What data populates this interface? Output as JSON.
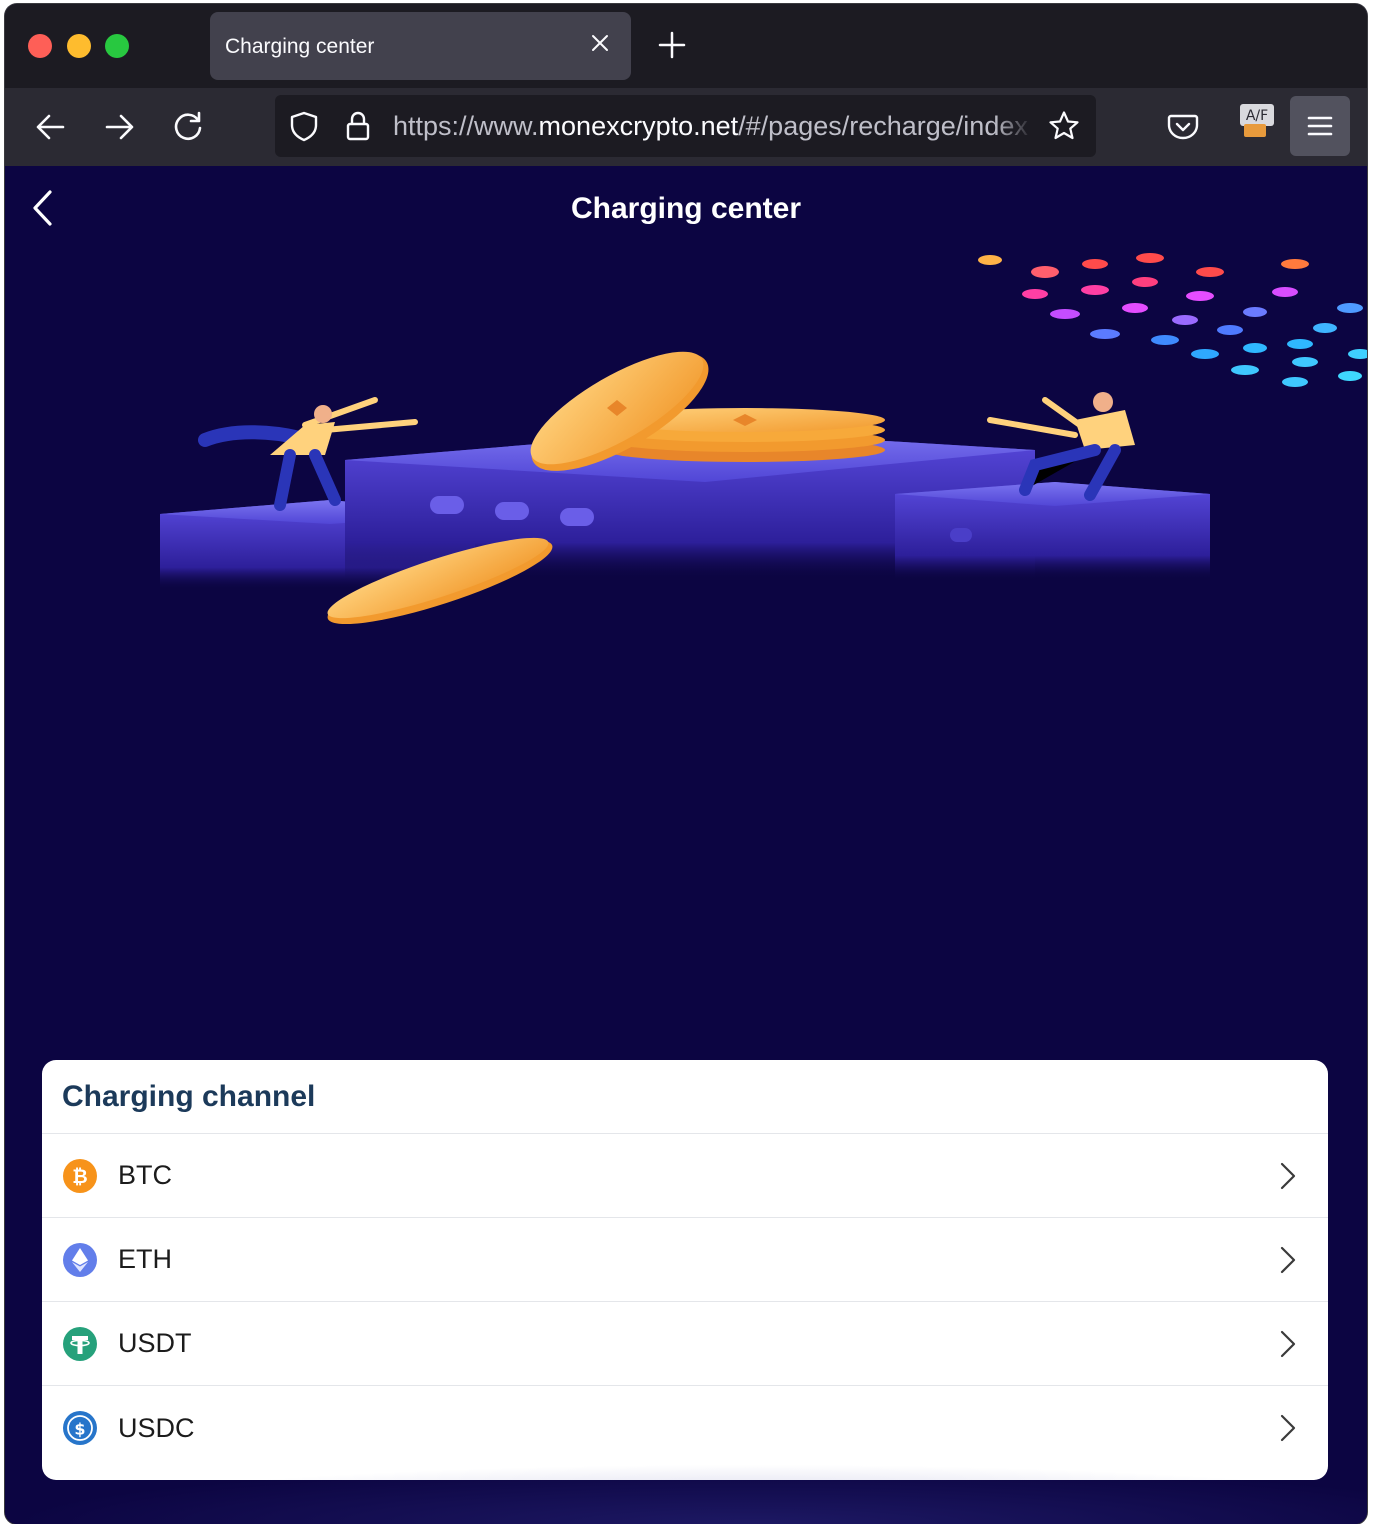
{
  "browser": {
    "tab": {
      "title": "Charging center"
    },
    "url": {
      "prefix": "https://www.",
      "host": "monexcrypto.net",
      "path": "/#/pages/recharge/index"
    },
    "extension_badge": "A/F"
  },
  "page": {
    "title": "Charging center",
    "channels_title": "Charging channel",
    "channels": [
      {
        "label": "BTC",
        "icon": "btc-icon",
        "color": "#f7931a"
      },
      {
        "label": "ETH",
        "icon": "eth-icon",
        "color": "#627eea"
      },
      {
        "label": "USDT",
        "icon": "usdt-icon",
        "color": "#26a17b"
      },
      {
        "label": "USDC",
        "icon": "usdc-icon",
        "color": "#2775ca"
      }
    ]
  },
  "colors": {
    "page_bg": "#0c0542",
    "card_title": "#1c3a5a",
    "coin_gold": "#f5a623"
  }
}
